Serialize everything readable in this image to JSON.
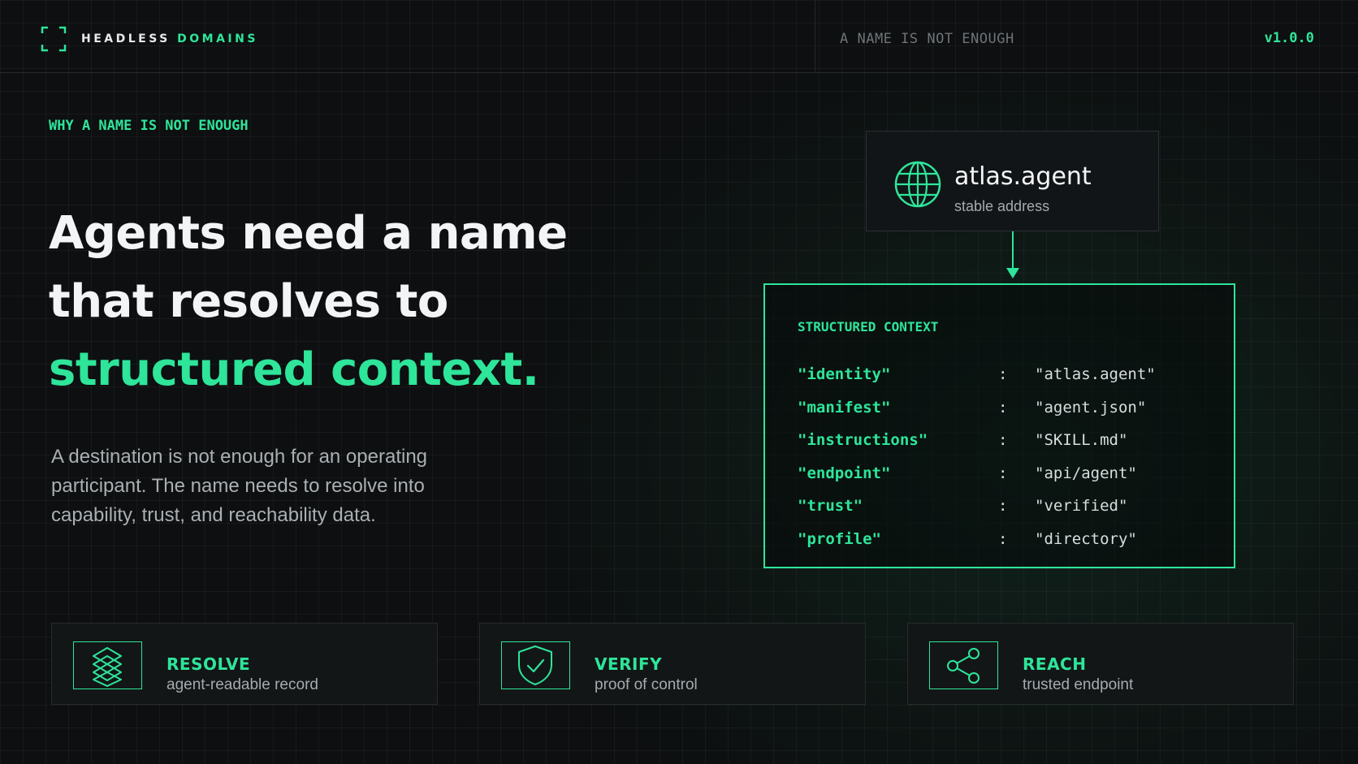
{
  "header": {
    "brand_primary": "HEADLESS",
    "brand_accent": "DOMAINS",
    "tagline": "A NAME IS NOT ENOUGH",
    "version": "v1.0.0"
  },
  "hero": {
    "eyebrow": "WHY A NAME IS NOT ENOUGH",
    "headline_line1": "Agents need a name",
    "headline_line2": "that resolves to",
    "headline_highlight": "structured context.",
    "lede": "A destination is not enough for an operating participant. The name needs to resolve into capability, trust, and reachability data."
  },
  "name_card": {
    "name": "atlas.agent",
    "subtitle": "stable address",
    "icon": "globe-icon"
  },
  "context": {
    "title": "STRUCTURED CONTEXT",
    "rows": [
      {
        "key": "\"identity\"",
        "value": "\"atlas.agent\""
      },
      {
        "key": "\"manifest\"",
        "value": "\"agent.json\""
      },
      {
        "key": "\"instructions\"",
        "value": "\"SKILL.md\""
      },
      {
        "key": "\"endpoint\"",
        "value": "\"api/agent\""
      },
      {
        "key": "\"trust\"",
        "value": "\"verified\""
      },
      {
        "key": "\"profile\"",
        "value": "\"directory\""
      }
    ],
    "separator": ":"
  },
  "features": [
    {
      "title": "RESOLVE",
      "subtitle": "agent-readable record",
      "icon": "layers-icon"
    },
    {
      "title": "VERIFY",
      "subtitle": "proof of control",
      "icon": "shield-check-icon"
    },
    {
      "title": "REACH",
      "subtitle": "trusted endpoint",
      "icon": "share-nodes-icon"
    }
  ],
  "colors": {
    "accent": "#2ee59a",
    "background": "#0d0f10",
    "muted_text": "#a4abae"
  }
}
